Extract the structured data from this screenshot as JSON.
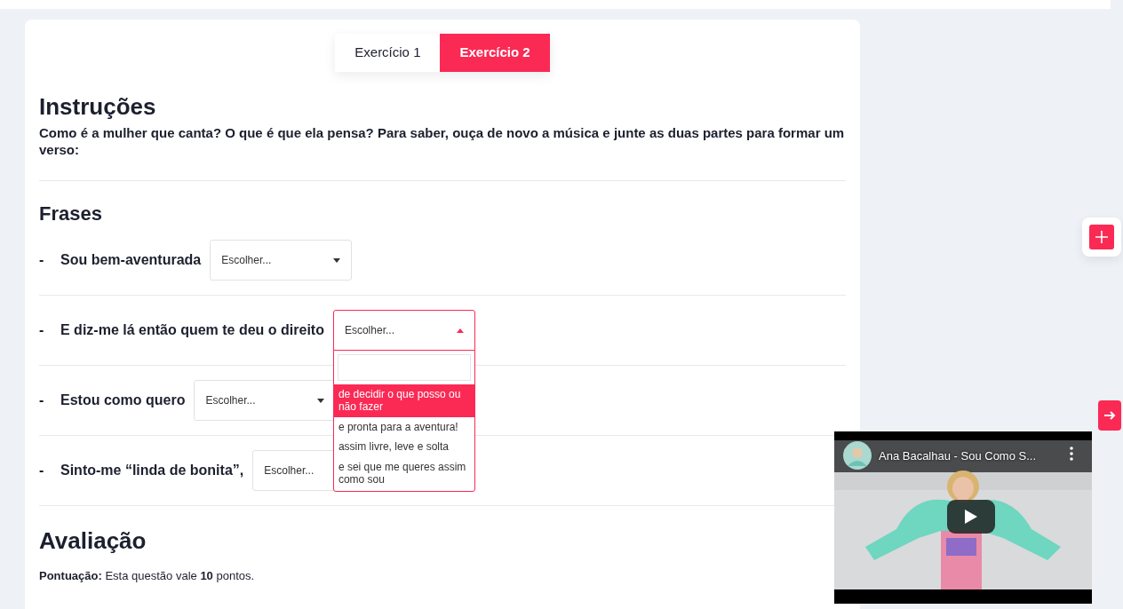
{
  "tabs": [
    {
      "label": "Exercício 1",
      "selected": false
    },
    {
      "label": "Exercício 2",
      "selected": true
    }
  ],
  "instructions": {
    "title": "Instruções",
    "text": "Como é a mulher que canta? O que é que ela pensa? Para saber, ouça de novo a música e junte as duas partes para formar um verso:"
  },
  "phrases": {
    "title": "Frases",
    "items": [
      {
        "dash": "-",
        "text": "Sou bem-aventurada",
        "select": {
          "value": "Escolher...",
          "expanded": false
        }
      },
      {
        "dash": "-",
        "text": "E diz-me lá então quem te deu o direito",
        "select": {
          "value": "Escolher...",
          "expanded": true,
          "options": [
            {
              "text": "de decidir o que posso ou não fazer",
              "selected": true
            },
            {
              "text": "e pronta para a aventura!",
              "selected": false
            },
            {
              "text": "assim livre, leve e solta",
              "selected": false
            },
            {
              "text": "e sei que me queres assim como sou",
              "selected": false
            }
          ]
        }
      },
      {
        "dash": "-",
        "text": "Estou como quero",
        "select": {
          "value": "Escolher...",
          "expanded": false
        }
      },
      {
        "dash": "-",
        "text": "Sinto-me “linda de bonita”,",
        "select": {
          "value": "Escolher...",
          "expanded": false
        }
      }
    ]
  },
  "evaluation": {
    "title": "Avaliação",
    "text": "**Pontuação:** Esta questão vale **10** pontos."
  },
  "video": {
    "title": "Ana Bacalhau - Sou Como S..."
  }
}
